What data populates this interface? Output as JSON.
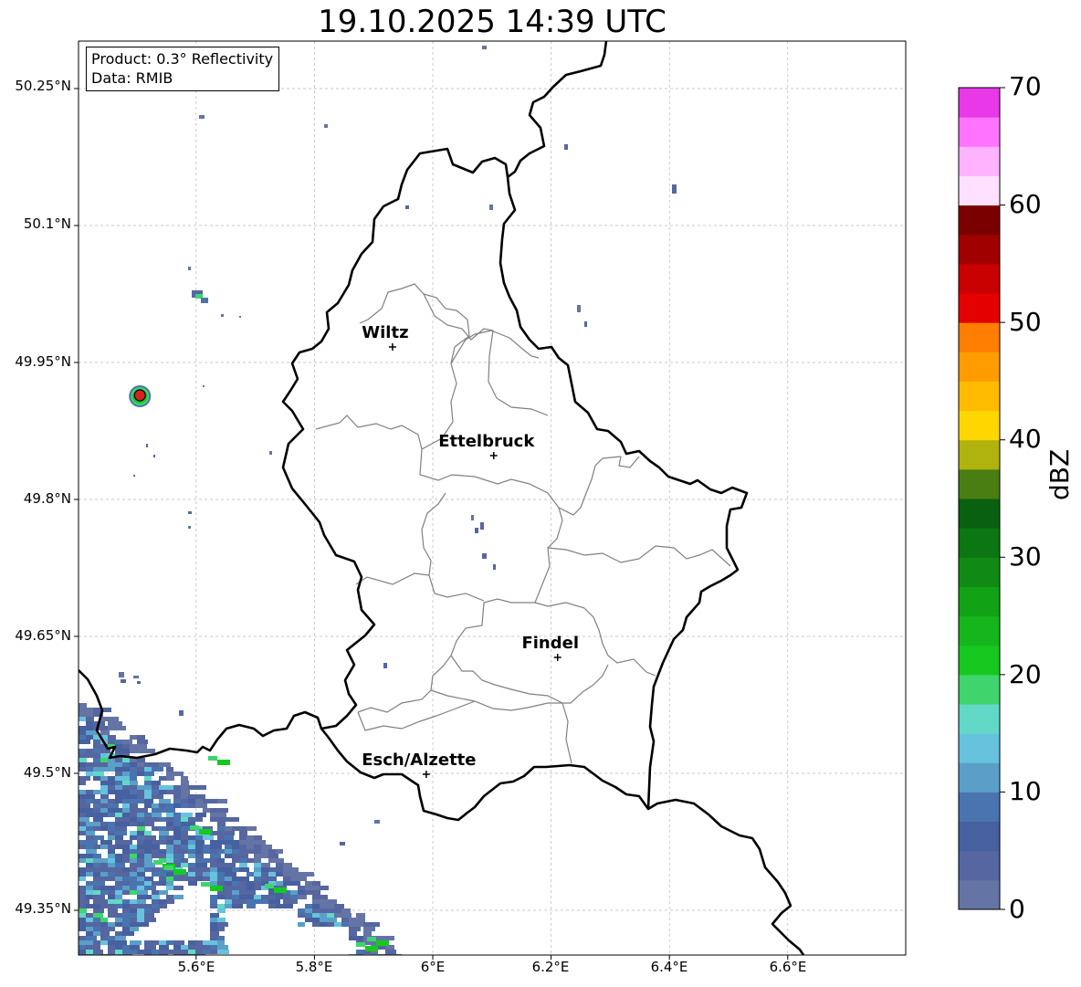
{
  "title": "19.10.2025 14:39 UTC",
  "info": {
    "product": "Product: 0.3° Reflectivity",
    "data": "Data: RMIB"
  },
  "lat_ticks": [
    "50.25°N",
    "50.1°N",
    "49.95°N",
    "49.8°N",
    "49.65°N",
    "49.5°N",
    "49.35°N"
  ],
  "lon_ticks": [
    "5.6°E",
    "5.8°E",
    "6°E",
    "6.2°E",
    "6.4°E",
    "6.6°E"
  ],
  "cities": [
    {
      "name": "Wiltz",
      "lon": 5.932,
      "lat": 49.967
    },
    {
      "name": "Ettelbruck",
      "lon": 6.103,
      "lat": 49.848
    },
    {
      "name": "Findel",
      "lon": 6.211,
      "lat": 49.627
    },
    {
      "name": "Esch/Alzette",
      "lon": 5.989,
      "lat": 49.499
    }
  ],
  "radar_marker": {
    "lon": 5.505,
    "lat": 49.914,
    "color": "#d62222"
  },
  "colorbar": {
    "unit": "dBZ",
    "min": 0,
    "max": 70,
    "step": 2.5,
    "tick_labels": [
      "0",
      "10",
      "20",
      "30",
      "40",
      "50",
      "60",
      "70"
    ],
    "colors": [
      "#6474a4",
      "#5566a0",
      "#47609f",
      "#4a74b0",
      "#5b9fc8",
      "#66c2dd",
      "#62d8c6",
      "#3fd46c",
      "#17c81e",
      "#14b61c",
      "#11a216",
      "#108a14",
      "#0c7612",
      "#086010",
      "#4a7d12",
      "#b0b20e",
      "#ffd600",
      "#ffbb00",
      "#ff9d00",
      "#ff7d00",
      "#e40000",
      "#c80000",
      "#a00000",
      "#7a0000",
      "#ffe0ff",
      "#ffb3ff",
      "#ff73ff",
      "#e838e8"
    ]
  },
  "style": {
    "border_color": "#000000",
    "canton_color": "#808080",
    "grid_color": "#b8b8b8"
  }
}
